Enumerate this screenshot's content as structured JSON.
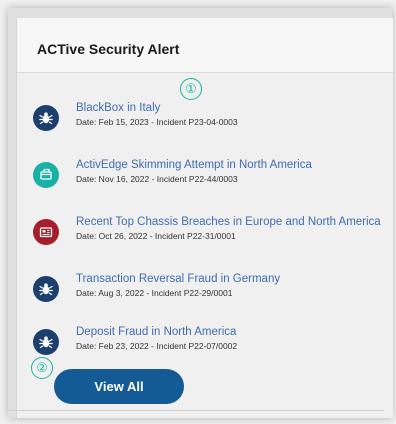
{
  "header": {
    "title": "ACTive Security Alert"
  },
  "markers": {
    "first": "①",
    "second": "②"
  },
  "alerts": [
    {
      "title": "BlackBox in Italy",
      "meta": "Date: Feb 15, 2023 - Incident P23-04-0003",
      "icon": "bug-icon",
      "color": "#1d3f6e"
    },
    {
      "title": "ActivEdge Skimming Attempt in North America",
      "meta": "Date: Nov 16, 2022 - Incident P22-44/0003",
      "icon": "card-reader-icon",
      "color": "#19b1a6"
    },
    {
      "title": "Recent Top Chassis Breaches in Europe and North America",
      "meta": "Date: Oct 26, 2022 - Incident P22-31/0001",
      "icon": "chassis-icon",
      "color": "#a61e2b"
    },
    {
      "title": "Transaction Reversal Fraud in Germany",
      "meta": "Date: Aug 3, 2022 - Incident P22-29/0001",
      "icon": "bug-icon",
      "color": "#1d3f6e"
    },
    {
      "title": "Deposit Fraud in North America",
      "meta": "Date: Feb 23, 2022 - Incident P22-07/0002",
      "icon": "bug-icon",
      "color": "#1d3f6e"
    }
  ],
  "footer": {
    "view_all_label": "View All"
  }
}
